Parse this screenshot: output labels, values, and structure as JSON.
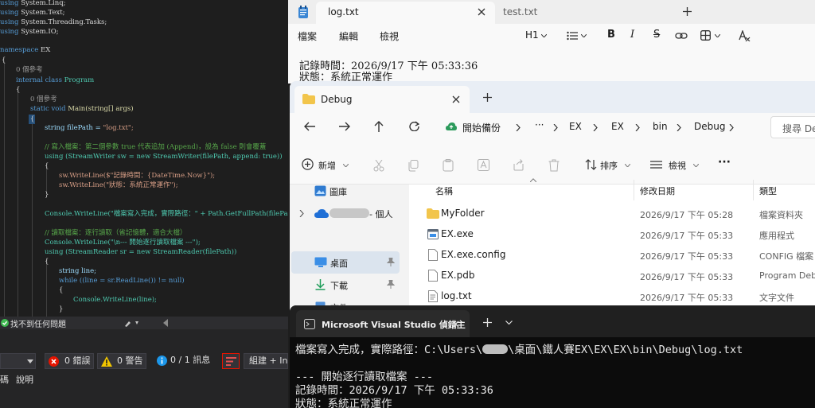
{
  "vs": {
    "code": {
      "using_linq": "System.Linq;",
      "using_text": "System.Text;",
      "using_tasks": "System.Threading.Tasks;",
      "using_io": "System.IO;",
      "kw_using": "using",
      "kw_namespace": "namespace",
      "namespace_name": "EX",
      "brace_open": "{",
      "brace_close": "}",
      "refs_zero": "0 個參考",
      "kw_internal_class": "internal class",
      "class_name": "Program",
      "kw_static_void": "static void",
      "main_sig": "Main(string[] args)",
      "filepath_decl": "string filePath = ",
      "filepath_value": "\"log.txt\";",
      "comment_write": "// 寫入檔案：第二個參數 true 代表追加 (Append)，設為 false 則會覆蓋",
      "using_writer": "using (StreamWriter sw = new StreamWriter(filePath, append: true))",
      "writeline_1": "sw.WriteLine($\"記錄時間：{DateTime.Now}\");",
      "writeline_2": "sw.WriteLine(\"狀態：系統正常運作\");",
      "console_path": "Console.WriteLine(\"檔案寫入完成，實際路徑：\" + Path.GetFullPath(filePa",
      "comment_read": "// 讀取檔案：逐行讀取（省記憶體，適合大檔）",
      "console_start": "Console.WriteLine(\"\\n--- 開始逐行讀取檔案 ---\");",
      "using_reader": "using (StreamReader sr = new StreamReader(filePath))",
      "string_line": "string line;",
      "while_line": "while ((line = sr.ReadLine()) != null)",
      "console_line": "Console.WriteLine(line);"
    },
    "status_bar": {
      "issues": "找不到任何問題"
    },
    "error_list": {
      "errors": "0 錯誤",
      "warnings": "0 警告",
      "messages": "0 / 1 訊息",
      "build_filter": "組建 + Int",
      "col_code": "碼",
      "col_description": "說明"
    }
  },
  "notepad": {
    "tabs": [
      "log.txt",
      "test.txt"
    ],
    "menu": [
      "檔案",
      "編輯",
      "檢視"
    ],
    "heading_selector": "H1",
    "lines": [
      "記錄時間：2026/9/17 下午 05:33:36",
      "狀態：系統正常運作"
    ]
  },
  "explorer": {
    "tab_title": "Debug",
    "breadcrumb": {
      "backup": "開始備份",
      "more": "···",
      "parts": [
        "EX",
        "EX",
        "bin",
        "Debug"
      ]
    },
    "search_placeholder": "搜尋 De",
    "commands": {
      "new": "新增",
      "sort": "排序",
      "view": "檢視",
      "more": "···"
    },
    "nav": {
      "pictures": "圖庫",
      "personal": "- 個人",
      "desktop": "桌面",
      "downloads": "下載",
      "documents": "文件"
    },
    "columns": {
      "name": "名稱",
      "modified": "修改日期",
      "type": "類型"
    },
    "files": [
      {
        "name": "MyFolder",
        "date": "2026/9/17 下午 05:28",
        "type": "檔案資料夾"
      },
      {
        "name": "EX.exe",
        "date": "2026/9/17 下午 05:33",
        "type": "應用程式"
      },
      {
        "name": "EX.exe.config",
        "date": "2026/9/17 下午 05:33",
        "type": "CONFIG 檔案"
      },
      {
        "name": "EX.pdb",
        "date": "2026/9/17 下午 05:33",
        "type": "Program Debu"
      },
      {
        "name": "log.txt",
        "date": "2026/9/17 下午 05:33",
        "type": "文字文件"
      }
    ]
  },
  "terminal": {
    "tab_title": "Microsoft Visual Studio 偵錯主",
    "path_prefix": "檔案寫入完成，實際路徑：C:\\Users\\",
    "path_suffix": "\\桌面\\鐵人賽EX\\EX\\EX\\bin\\Debug\\log.txt",
    "line_2": "--- 開始逐行讀取檔案 ---",
    "line_3": "記錄時間：2026/9/17 下午 05:33:36",
    "line_4": "狀態：系統正常運作"
  },
  "colors": {
    "vs_background": "#1e1e1e",
    "terminal_background": "#0c0c0c",
    "explorer_selected": "#dbe4ee",
    "error_red": "#e51400",
    "warning_yellow": "#f2c600",
    "info_blue": "#1c97ea"
  }
}
